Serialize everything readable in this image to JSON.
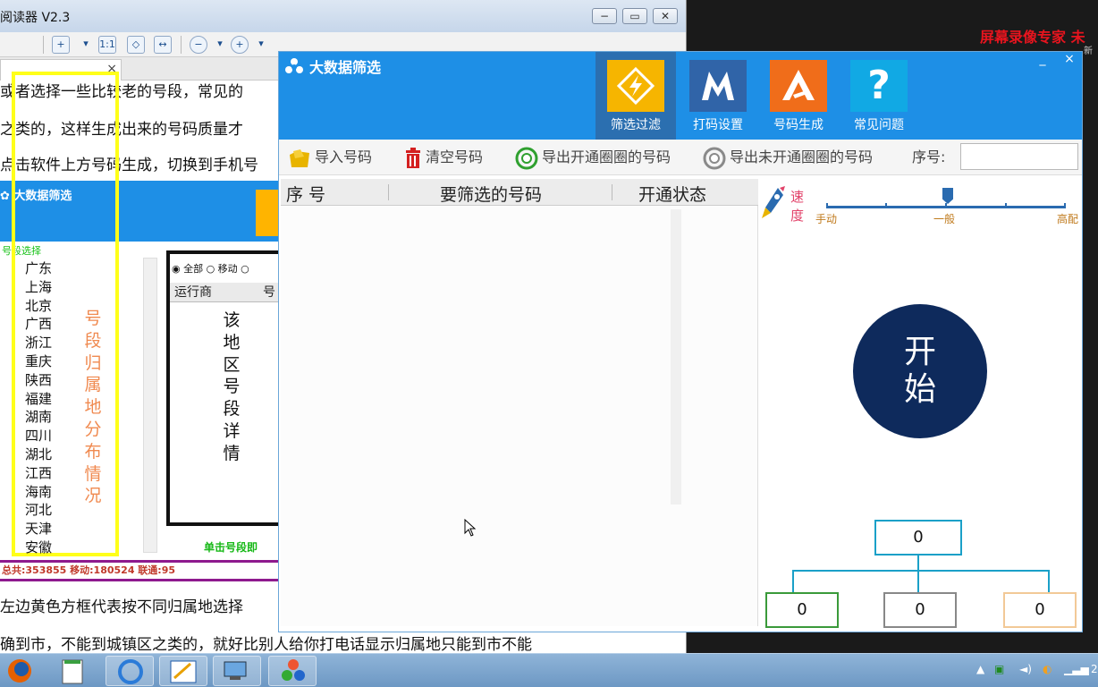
{
  "desktop": {
    "recorder_brand": "屏幕录像专家 未",
    "recorder_sub": "新"
  },
  "reader": {
    "title": "阅读器 V2.3",
    "lines": [
      "或者选择一些比较老的号段，常见的",
      "之类的，这样生成出来的号码质量才",
      "点击软件上方号码生成，切换到手机号",
      "左边黄色方框代表按不同归属地选择",
      "确到市，不能到城镇区之类的，就好比别人给你打电话显示归属地只能到市不能"
    ],
    "embedded": {
      "title": "大数据筛选",
      "section_label": "号段选择",
      "provinces": [
        "广东",
        "上海",
        "北京",
        "广西",
        "浙江",
        "重庆",
        "陕西",
        "福建",
        "湖南",
        "四川",
        "湖北",
        "江西",
        "海南",
        "河北",
        "天津",
        "安徽"
      ],
      "yellow_caption": "号段归属地分布情况",
      "radio_options": "◉ 全部  ○ 移动  ○",
      "operator_header": "运行商",
      "operator_header_2": "号",
      "black_caption": "该地区号段详情",
      "green_hint": "单击号段即",
      "stats": "总共:353855       移动:180524       联通:95"
    }
  },
  "app": {
    "title": "大数据筛选",
    "window_min": "_",
    "window_close": "×",
    "nav": [
      {
        "label": "筛选过滤",
        "icon": "lightning-icon",
        "active": true
      },
      {
        "label": "打码设置",
        "icon": "m-logo-icon",
        "active": false
      },
      {
        "label": "号码生成",
        "icon": "a-logo-icon",
        "active": false
      },
      {
        "label": "常见问题",
        "icon": "question-icon",
        "active": false
      }
    ],
    "toolbar": {
      "import": "导入号码",
      "clear": "清空号码",
      "export_open": "导出开通圈圈的号码",
      "export_unopen": "导出未开通圈圈的号码",
      "serial_label": "序号:",
      "serial_value": ""
    },
    "table": {
      "columns": [
        "序 号",
        "要筛选的号码",
        "开通状态"
      ],
      "rows": []
    },
    "speed": {
      "label": "速度",
      "ticks": [
        "手动",
        "一般",
        "高配"
      ],
      "selected": "一般"
    },
    "start_label": "开始",
    "counters": {
      "total": "0",
      "left": "0",
      "middle": "0",
      "right": "0"
    }
  },
  "taskbar": {
    "apps": [
      "firefox-icon",
      "notepad-icon",
      "browser-icon",
      "paint-icon",
      "network-icon",
      "app-icon"
    ],
    "clock": "2"
  }
}
